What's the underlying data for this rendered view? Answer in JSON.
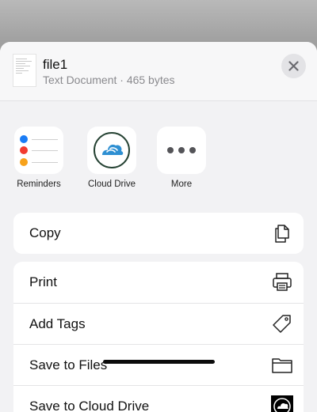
{
  "file": {
    "name": "file1",
    "meta": "Text Document · 465 bytes"
  },
  "apps": [
    {
      "label": "Reminders",
      "icon": "reminders-icon"
    },
    {
      "label": "Cloud Drive",
      "icon": "cloud-drive-icon"
    },
    {
      "label": "More",
      "icon": "more-icon"
    }
  ],
  "actions_group1": [
    {
      "label": "Copy",
      "icon": "copy-icon"
    }
  ],
  "actions_group2": [
    {
      "label": "Print",
      "icon": "printer-icon"
    },
    {
      "label": "Add Tags",
      "icon": "tag-icon"
    },
    {
      "label": "Save to Files",
      "icon": "folder-icon"
    },
    {
      "label": "Save to Cloud Drive",
      "icon": "cloud-drive-icon"
    }
  ],
  "colors": {
    "reminder_blue": "#1a7cf5",
    "reminder_red": "#f23b30",
    "reminder_orange": "#f7a21b",
    "cloud_blue": "#2e8fd2",
    "cloud_ring": "#254233"
  }
}
